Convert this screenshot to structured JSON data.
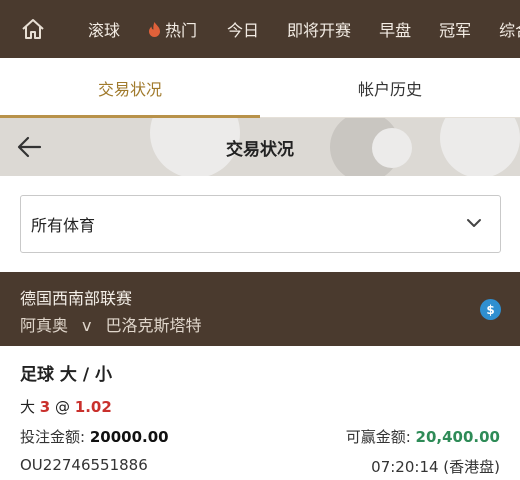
{
  "nav": {
    "items": [
      "滚球",
      "热门",
      "今日",
      "即将开赛",
      "早盘",
      "冠军",
      "综合"
    ]
  },
  "tabs": [
    "交易状况",
    "帐户历史"
  ],
  "header": {
    "title": "交易状况"
  },
  "filter": {
    "value": "所有体育"
  },
  "league": {
    "name": "德国西南部联赛",
    "home": "阿真奥",
    "vs": "v",
    "away": "巴洛克斯塔特",
    "badge": "$"
  },
  "bet": {
    "type": "足球 大 / 小",
    "selection": "大",
    "line": "3",
    "at": "@",
    "odds": "1.02",
    "stake_label": "投注金额:",
    "stake": "20000.00",
    "win_label": "可赢金额:",
    "win": "20,400.00",
    "ref": "OU22746551886",
    "time": "07:20:14 (香港盘)"
  },
  "colors": {
    "brand_dark": "#4a3a2e",
    "accent_gold": "#b8924a",
    "odds_red": "#c9302c",
    "win_green": "#2e8b57"
  }
}
